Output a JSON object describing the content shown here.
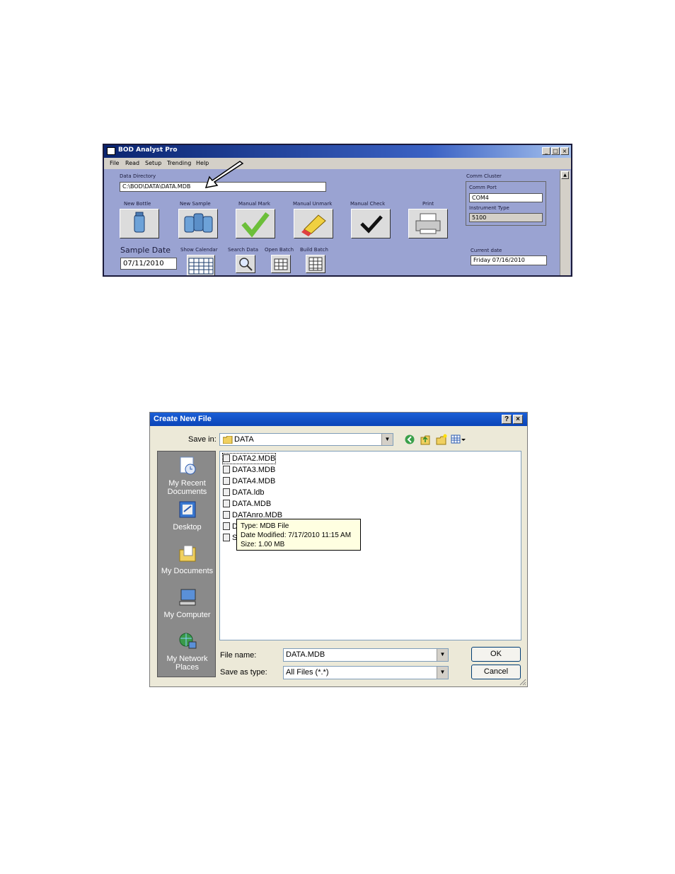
{
  "bod": {
    "title": "BOD Analyst Pro",
    "menu": [
      "File",
      "Read",
      "Setup",
      "Trending",
      "Help"
    ],
    "data_directory_label": "Data Directory",
    "data_directory_value": "C:\\BOD\\DATA\\DATA.MDB",
    "buttons": [
      "New Bottle",
      "New Sample",
      "Manual Mark",
      "Manual Unmark",
      "Manual Check",
      "Print"
    ],
    "sample_date_label": "Sample Date",
    "sample_date_value": "07/11/2010",
    "small_buttons": [
      "Show Calendar",
      "Search Data",
      "Open Batch",
      "Build Batch"
    ],
    "comm_cluster_label": "Comm Cluster",
    "comm_port_label": "Comm Port",
    "comm_port_value": "COM4",
    "instrument_type_label": "Instrument Type",
    "instrument_type_value": "5100",
    "current_date_label": "Current date",
    "current_date_value": "Friday 07/16/2010"
  },
  "dialog": {
    "title": "Create New File",
    "help_glyph": "?",
    "close_glyph": "×",
    "save_in_label": "Save in:",
    "save_in_value": "DATA",
    "places": [
      "My Recent Documents",
      "Desktop",
      "My Documents",
      "My Computer",
      "My Network Places"
    ],
    "files": [
      "DATA2.MDB",
      "DATA3.MDB",
      "DATA4.MDB",
      "DATA.ldb",
      "DATA.MDB",
      "DATAnro.MDB",
      "D",
      "S"
    ],
    "tooltip": {
      "type": "Type: MDB File",
      "modified": "Date Modified: 7/17/2010 11:15 AM",
      "size": "Size: 1.00 MB"
    },
    "file_name_label": "File name:",
    "file_name_value": "DATA.MDB",
    "save_as_type_label": "Save as type:",
    "save_as_type_value": "All Files (*.*)",
    "ok_label": "OK",
    "cancel_label": "Cancel"
  }
}
